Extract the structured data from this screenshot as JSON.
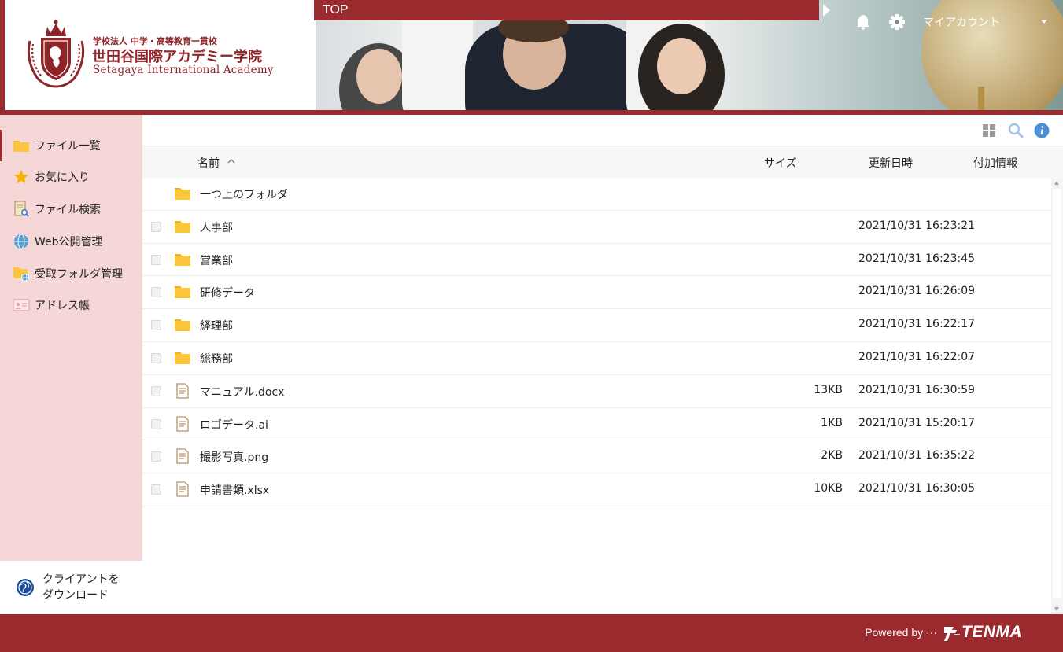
{
  "header": {
    "school_sub": "学校法人 中学・高等教育一貫校",
    "school_name": "世田谷国際アカデミー学院",
    "school_en": "Setagaya International Academy",
    "top_tab": "TOP",
    "account_label": "マイアカウント"
  },
  "sidebar": {
    "items": [
      {
        "label": "ファイル一覧",
        "icon": "folder-icon"
      },
      {
        "label": "お気に入り",
        "icon": "star-icon"
      },
      {
        "label": "ファイル検索",
        "icon": "file-search-icon"
      },
      {
        "label": "Web公開管理",
        "icon": "globe-icon"
      },
      {
        "label": "受取フォルダ管理",
        "icon": "folder-globe-icon"
      },
      {
        "label": "アドレス帳",
        "icon": "address-book-icon"
      }
    ],
    "download_label": "クライアントを ダウンロード"
  },
  "table": {
    "columns": {
      "name": "名前",
      "size": "サイズ",
      "modified": "更新日時",
      "extra": "付加情報"
    },
    "parent_folder": "一つ上のフォルダ",
    "rows": [
      {
        "name": "人事部",
        "type": "folder",
        "size": "",
        "date": "2021/10/31 16:23:21"
      },
      {
        "name": "営業部",
        "type": "folder",
        "size": "",
        "date": "2021/10/31 16:23:45"
      },
      {
        "name": "研修データ",
        "type": "folder",
        "size": "",
        "date": "2021/10/31 16:26:09"
      },
      {
        "name": "経理部",
        "type": "folder",
        "size": "",
        "date": "2021/10/31 16:22:17"
      },
      {
        "name": "総務部",
        "type": "folder",
        "size": "",
        "date": "2021/10/31 16:22:07"
      },
      {
        "name": "マニュアル.docx",
        "type": "file",
        "size": "13KB",
        "date": "2021/10/31 16:30:59"
      },
      {
        "name": "ロゴデータ.ai",
        "type": "file",
        "size": "1KB",
        "date": "2021/10/31 15:20:17"
      },
      {
        "name": "撮影写真.png",
        "type": "file",
        "size": "2KB",
        "date": "2021/10/31 16:35:22"
      },
      {
        "name": "申請書類.xlsx",
        "type": "file",
        "size": "10KB",
        "date": "2021/10/31 16:30:05"
      }
    ]
  },
  "footer": {
    "powered_by": "Powered by ···",
    "brand": "TENMA"
  },
  "colors": {
    "accent": "#9b2a2e",
    "sidebar_bg": "#f6d7d8",
    "folder": "#fbc53d",
    "info_blue": "#4a90d9"
  }
}
